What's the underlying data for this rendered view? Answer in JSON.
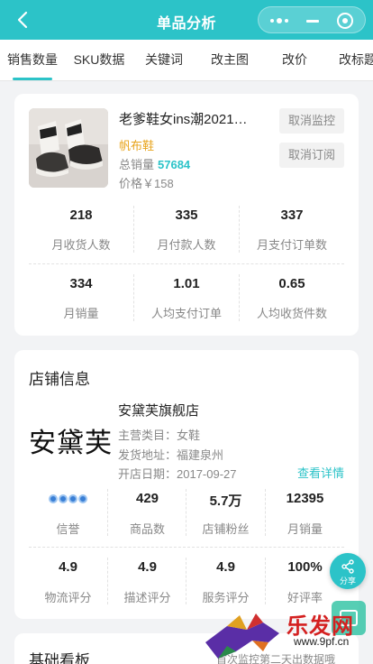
{
  "header": {
    "title": "单品分析"
  },
  "tabs": [
    {
      "label": "销售数量",
      "active": true
    },
    {
      "label": "SKU数据",
      "active": false
    },
    {
      "label": "关键词",
      "active": false
    },
    {
      "label": "改主图",
      "active": false
    },
    {
      "label": "改价",
      "active": false
    },
    {
      "label": "改标题",
      "active": false
    }
  ],
  "product": {
    "name": "老爹鞋女ins潮2021…",
    "tag": "帆布鞋",
    "sales_label": "总销量",
    "sales_value": "57684",
    "price": "价格￥158",
    "btn_cancel_monitor": "取消监控",
    "btn_cancel_subscribe": "取消订阅"
  },
  "product_stats": [
    {
      "value": "218",
      "label": "月收货人数"
    },
    {
      "value": "335",
      "label": "月付款人数"
    },
    {
      "value": "337",
      "label": "月支付订单数"
    },
    {
      "value": "334",
      "label": "月销量"
    },
    {
      "value": "1.01",
      "label": "人均支付订单"
    },
    {
      "value": "0.65",
      "label": "人均收货件数"
    }
  ],
  "shop": {
    "section_title": "店铺信息",
    "logo_text": "安黛芙",
    "name": "安黛芙旗舰店",
    "category": "主营类目：女鞋",
    "address": "发货地址：福建泉州",
    "opened": "开店日期：2017-09-27",
    "detail_link": "查看详情"
  },
  "shop_stats": [
    {
      "value": "",
      "label": "信誉",
      "icon": "crown-icon",
      "crowns": 4
    },
    {
      "value": "429",
      "label": "商品数"
    },
    {
      "value": "5.7万",
      "label": "店铺粉丝"
    },
    {
      "value": "12395",
      "label": "月销量"
    },
    {
      "value": "4.9",
      "label": "物流评分"
    },
    {
      "value": "4.9",
      "label": "描述评分"
    },
    {
      "value": "4.9",
      "label": "服务评分"
    },
    {
      "value": "100%",
      "label": "好评率"
    }
  ],
  "fab": {
    "share_label": "分享"
  },
  "dashboard": {
    "section_title": "基础看板",
    "note": "首次监控第二天出数据哦"
  },
  "watermark": {
    "text": "乐发网",
    "url": "www.9pf.cn"
  },
  "colors": {
    "accent": "#2cc3c8",
    "tag": "#e8a41c",
    "watermark_red": "#d42020"
  }
}
